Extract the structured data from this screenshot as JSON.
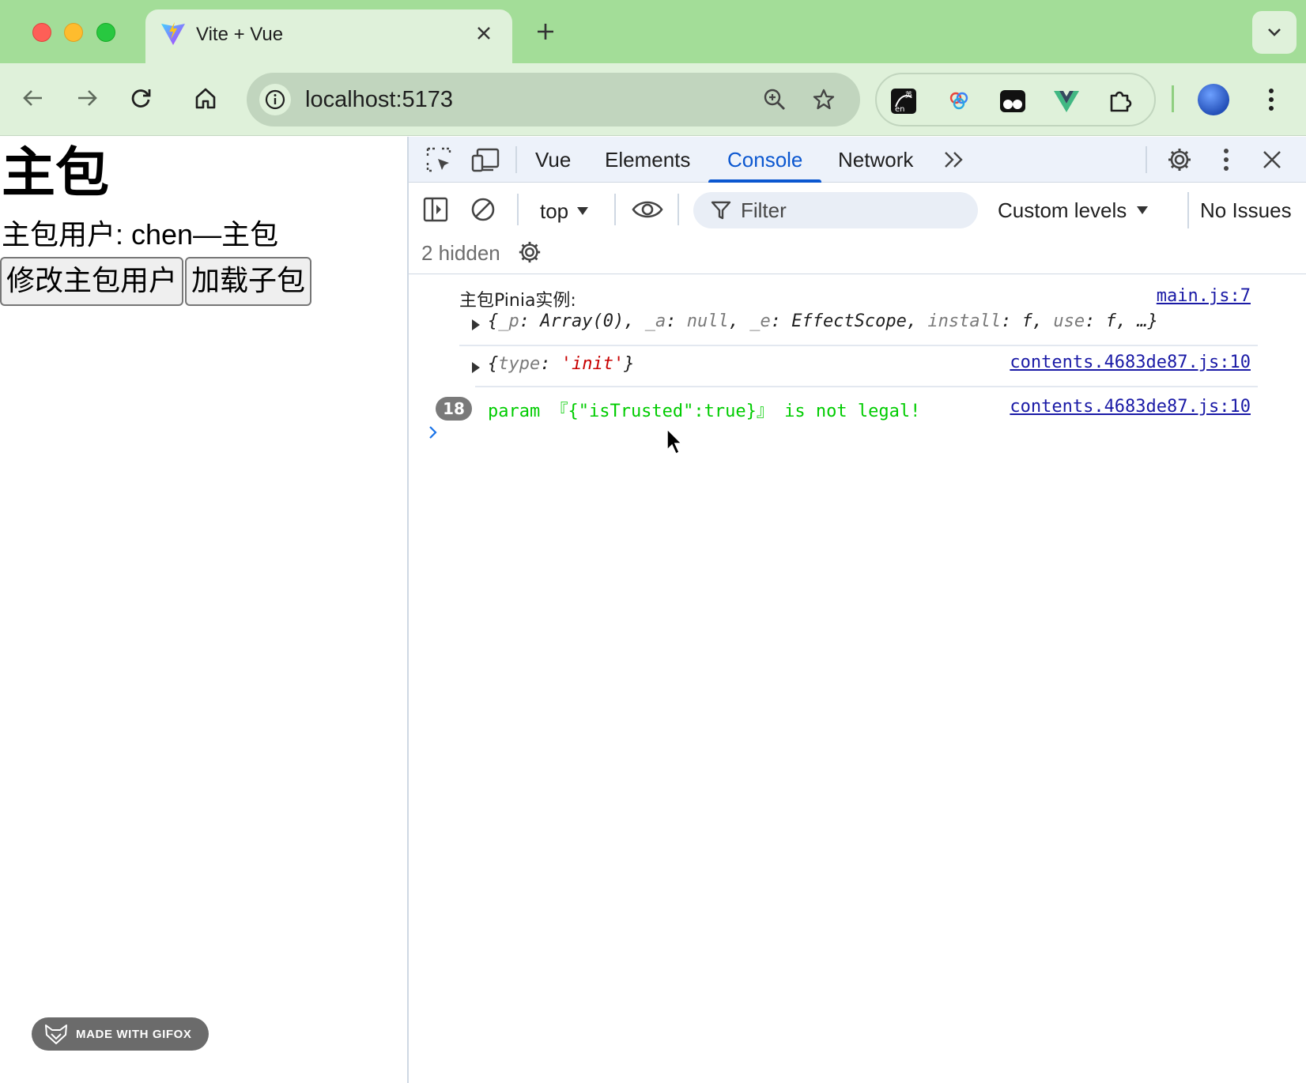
{
  "browser": {
    "tab": {
      "title": "Vite + Vue",
      "favicon": "vite-icon"
    },
    "url": "localhost:5173",
    "icons": [
      "back-arrow-icon",
      "forward-arrow-icon",
      "reload-icon",
      "home-icon",
      "site-info-icon",
      "zoom-icon",
      "bookmark-star-icon",
      "translate-extension-icon",
      "baidu-extension-icon",
      "tampermonkey-extension-icon",
      "vue-devtools-extension-icon",
      "extensions-puzzle-icon",
      "profile-avatar",
      "kebab-menu-icon"
    ]
  },
  "page": {
    "heading": "主包",
    "user_line": "主包用户: chen—主包",
    "buttons": {
      "modify_user": "修改主包用户",
      "load_subpackage": "加载子包"
    },
    "badge": "MADE WITH GIFOX"
  },
  "devtools": {
    "tabs": {
      "vue": "Vue",
      "elements": "Elements",
      "console": "Console",
      "network": "Network"
    },
    "active_tab": "Console",
    "context": "top",
    "filter_placeholder": "Filter",
    "levels": "Custom levels",
    "issues": "No Issues",
    "hidden": "2 hidden",
    "accent_color": "#0b57d0",
    "messages": [
      {
        "label": "主包Pinia实例:",
        "source": "main.js:7",
        "object_parts": {
          "p_key": "_p",
          "p_val": "Array(0)",
          "a_key": "_a",
          "a_val": "null",
          "e_key": "_e",
          "e_val": "EffectScope",
          "install_key": "install",
          "install_val": "f",
          "use_key": "use",
          "use_val": "f",
          "ellipsis": "…"
        }
      },
      {
        "object_parts": {
          "type_key": "type",
          "type_val": "'init'"
        },
        "source": "contents.4683de87.js:10"
      },
      {
        "count": "18",
        "text": "param 『{\"isTrusted\":true}』 is not legal!",
        "source": "contents.4683de87.js:10",
        "color": "#00cc00"
      }
    ],
    "prompt": ">"
  }
}
